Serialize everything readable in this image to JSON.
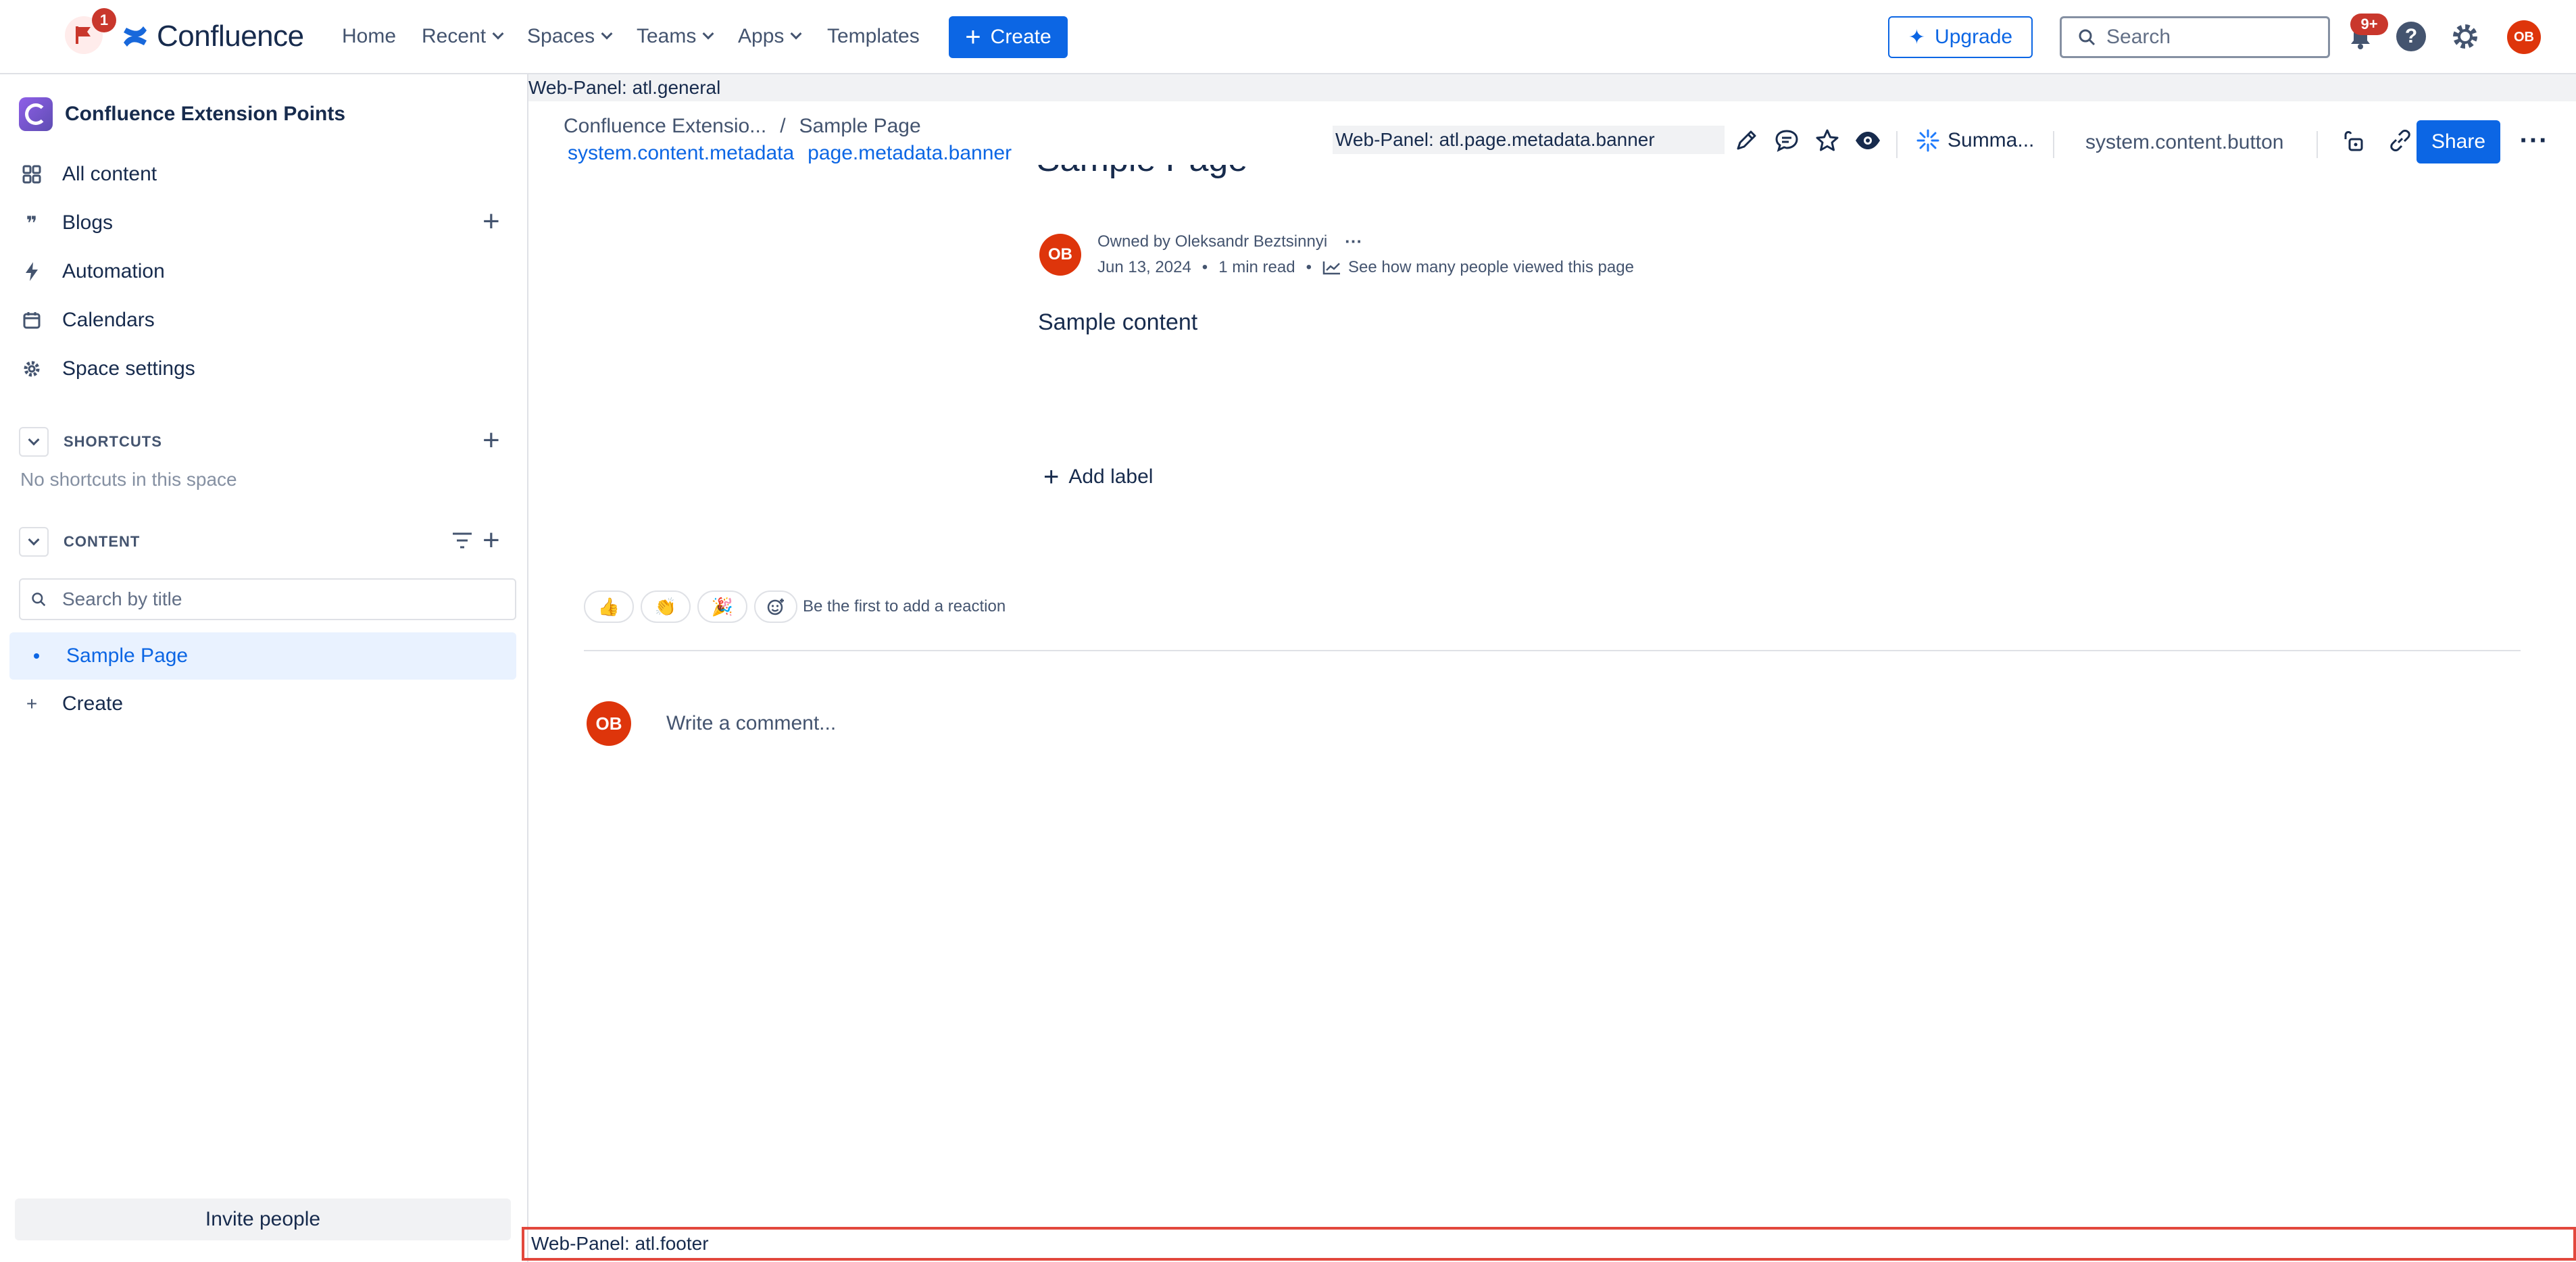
{
  "topnav": {
    "flag_count": "1",
    "brand": "Confluence",
    "links": {
      "home": "Home",
      "recent": "Recent",
      "spaces": "Spaces",
      "teams": "Teams",
      "apps": "Apps",
      "templates": "Templates"
    },
    "create_label": "Create",
    "upgrade_label": "Upgrade",
    "search_placeholder": "Search",
    "notification_count": "9+",
    "avatar_initials": "OB"
  },
  "sidebar": {
    "space_name": "Confluence Extension Points",
    "items": {
      "all_content": "All content",
      "blogs": "Blogs",
      "automation": "Automation",
      "calendars": "Calendars",
      "space_settings": "Space settings"
    },
    "shortcuts": {
      "title": "SHORTCUTS",
      "empty": "No shortcuts in this space"
    },
    "content": {
      "title": "CONTENT",
      "search_placeholder": "Search by title",
      "tree_item": "Sample Page",
      "create_label": "Create"
    },
    "invite_label": "Invite people"
  },
  "main": {
    "webpanel_general": "Web-Panel: atl.general",
    "breadcrumb": {
      "space": "Confluence Extensio...",
      "separator": "/",
      "page": "Sample Page"
    },
    "links": {
      "content_metadata": "system.content.metadata",
      "metadata_banner": "page.metadata.banner"
    },
    "banner_panel": "Web-Panel: atl.page.metadata.banner",
    "summarize_label": "Summa...",
    "system_content_button": "system.content.button",
    "share_label": "Share",
    "page_title": "Sample Page",
    "author": {
      "initials": "OB",
      "owned_by": "Owned by Oleksandr Beztsinnyi",
      "date": "Jun 13, 2024",
      "read_time": "1 min read",
      "analytics": "See how many people viewed this page"
    },
    "body": "Sample content",
    "add_label": "Add label",
    "reactions": {
      "emoji": [
        "👍",
        "👏",
        "🎉"
      ],
      "prompt": "Be the first to add a reaction"
    },
    "comment": {
      "initials": "OB",
      "placeholder": "Write a comment..."
    },
    "webpanel_footer": "Web-Panel: atl.footer"
  },
  "colors": {
    "primary": "#0c66e4",
    "danger": "#c9372c",
    "avatar": "#de350b",
    "footer_outline": "#e2483d"
  }
}
